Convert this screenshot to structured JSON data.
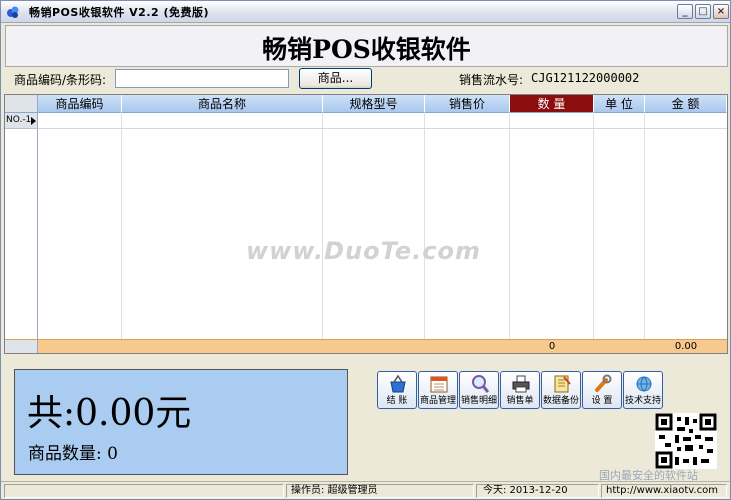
{
  "window": {
    "title": "畅销POS收银软件 V2.2 (免费版)",
    "heading": "畅销POS收银软件"
  },
  "search": {
    "label": "商品编码/条形码:",
    "value": "",
    "goods_button": "商品...",
    "serial_label": "销售流水号:",
    "serial_value": "CJG121122000002"
  },
  "grid": {
    "columns": [
      "商品编码",
      "商品名称",
      "规格型号",
      "销售价",
      "数 量",
      "单 位",
      "金 额"
    ],
    "row_label": "NO.-1",
    "footer": {
      "quantity": "0",
      "amount": "0.00"
    }
  },
  "watermark": "www.DuoTe.com",
  "totals": {
    "total": "共:0.00元",
    "quantity": "商品数量: 0"
  },
  "toolbar": [
    {
      "label": "结 账",
      "icon": "basket-icon"
    },
    {
      "label": "商品管理",
      "icon": "calendar-icon"
    },
    {
      "label": "销售明细",
      "icon": "magnifier-icon"
    },
    {
      "label": "销售单",
      "icon": "printer-icon"
    },
    {
      "label": "数据备份",
      "icon": "notebook-icon"
    },
    {
      "label": "设 置",
      "icon": "wrench-icon"
    },
    {
      "label": "技术支持",
      "icon": "globe-icon"
    }
  ],
  "logo_text": "国内最安全的软件站",
  "status": {
    "operator": "操作员: 超级管理员",
    "date": "今天: 2013-12-20",
    "url": "http://www.xiaotv.com"
  },
  "colors": {
    "highlight_header": "#8b0d0d",
    "total_panel": "#a9ccf0",
    "footer_row": "#f8c98c"
  }
}
